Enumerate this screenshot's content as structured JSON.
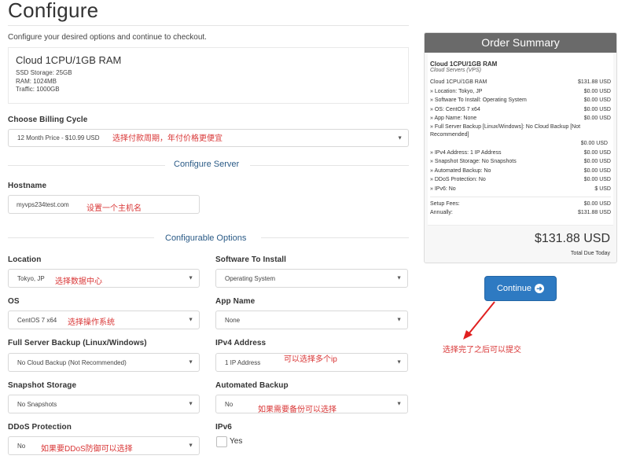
{
  "page": {
    "title": "Configure",
    "subtitle": "Configure your desired options and continue to checkout."
  },
  "product": {
    "name": "Cloud 1CPU/1GB RAM",
    "specs": [
      "SSD Storage: 25GB",
      "RAM: 1024MB",
      "Traffic: 1000GB"
    ]
  },
  "billing": {
    "label": "Choose Billing Cycle",
    "value": "12 Month Price - $10.99 USD",
    "note": "选择付款周期，年付价格更便宜"
  },
  "configure_server": {
    "section_title": "Configure Server",
    "hostname_label": "Hostname",
    "hostname_value": "myvps234test.com",
    "hostname_note": "设置一个主机名"
  },
  "configurable_options": {
    "section_title": "Configurable Options",
    "location": {
      "label": "Location",
      "value": "Tokyo, JP",
      "note": "选择数据中心"
    },
    "software": {
      "label": "Software To Install",
      "value": "Operating System"
    },
    "os": {
      "label": "OS",
      "value": "CentOS 7 x64",
      "note": "选择操作系统"
    },
    "app_name": {
      "label": "App Name",
      "value": "None"
    },
    "backup": {
      "label": "Full Server Backup (Linux/Windows)",
      "value": "No Cloud Backup (Not Recommended)"
    },
    "ipv4": {
      "label": "IPv4 Address",
      "value": "1 IP Address",
      "note": "可以选择多个ip"
    },
    "snapshot": {
      "label": "Snapshot Storage",
      "value": "No Snapshots"
    },
    "auto_backup": {
      "label": "Automated Backup",
      "value": "No",
      "note": "如果需要备份可以选择"
    },
    "ddos": {
      "label": "DDoS Protection",
      "value": "No",
      "note": "如果要DDoS防御可以选择"
    },
    "ipv6": {
      "label": "IPv6",
      "option": "Yes"
    }
  },
  "order_summary": {
    "title": "Order Summary",
    "product_name": "Cloud 1CPU/1GB RAM",
    "product_group": "Cloud Servers (VPS)",
    "lines": [
      {
        "label": "Cloud 1CPU/1GB RAM",
        "price": "$131.88 USD"
      },
      {
        "label": "» Location: Tokyo, JP",
        "price": "$0.00 USD"
      },
      {
        "label": "» Software To Install: Operating System",
        "price": "$0.00 USD"
      },
      {
        "label": "» OS: CentOS 7 x64",
        "price": "$0.00 USD"
      },
      {
        "label": "» App Name: None",
        "price": "$0.00 USD"
      }
    ],
    "backup_line": "» Full Server Backup [Linux/Windows]: No Cloud Backup [Not Recommended]",
    "backup_price": "$0.00 USD",
    "lines2": [
      {
        "label": "» IPv4 Address: 1 IP Address",
        "price": "$0.00 USD"
      },
      {
        "label": "» Snapshot Storage: No Snapshots",
        "price": "$0.00 USD"
      },
      {
        "label": "» Automated Backup: No",
        "price": "$0.00 USD"
      },
      {
        "label": "» DDoS Protection: No",
        "price": "$0.00 USD"
      },
      {
        "label": "» IPv6: No",
        "price": "$ USD"
      }
    ],
    "setup_fees_label": "Setup Fees:",
    "setup_fees": "$0.00 USD",
    "annually_label": "Annually:",
    "annually": "$131.88 USD",
    "total": "$131.88 USD",
    "total_label": "Total Due Today"
  },
  "continue": {
    "label": "Continue",
    "note": "选择完了之后可以提交"
  },
  "colors": {
    "accent": "#2e7ac2",
    "annotation": "#d93636",
    "summary_header": "#6a6a6a",
    "section_title": "#2a5a86"
  }
}
